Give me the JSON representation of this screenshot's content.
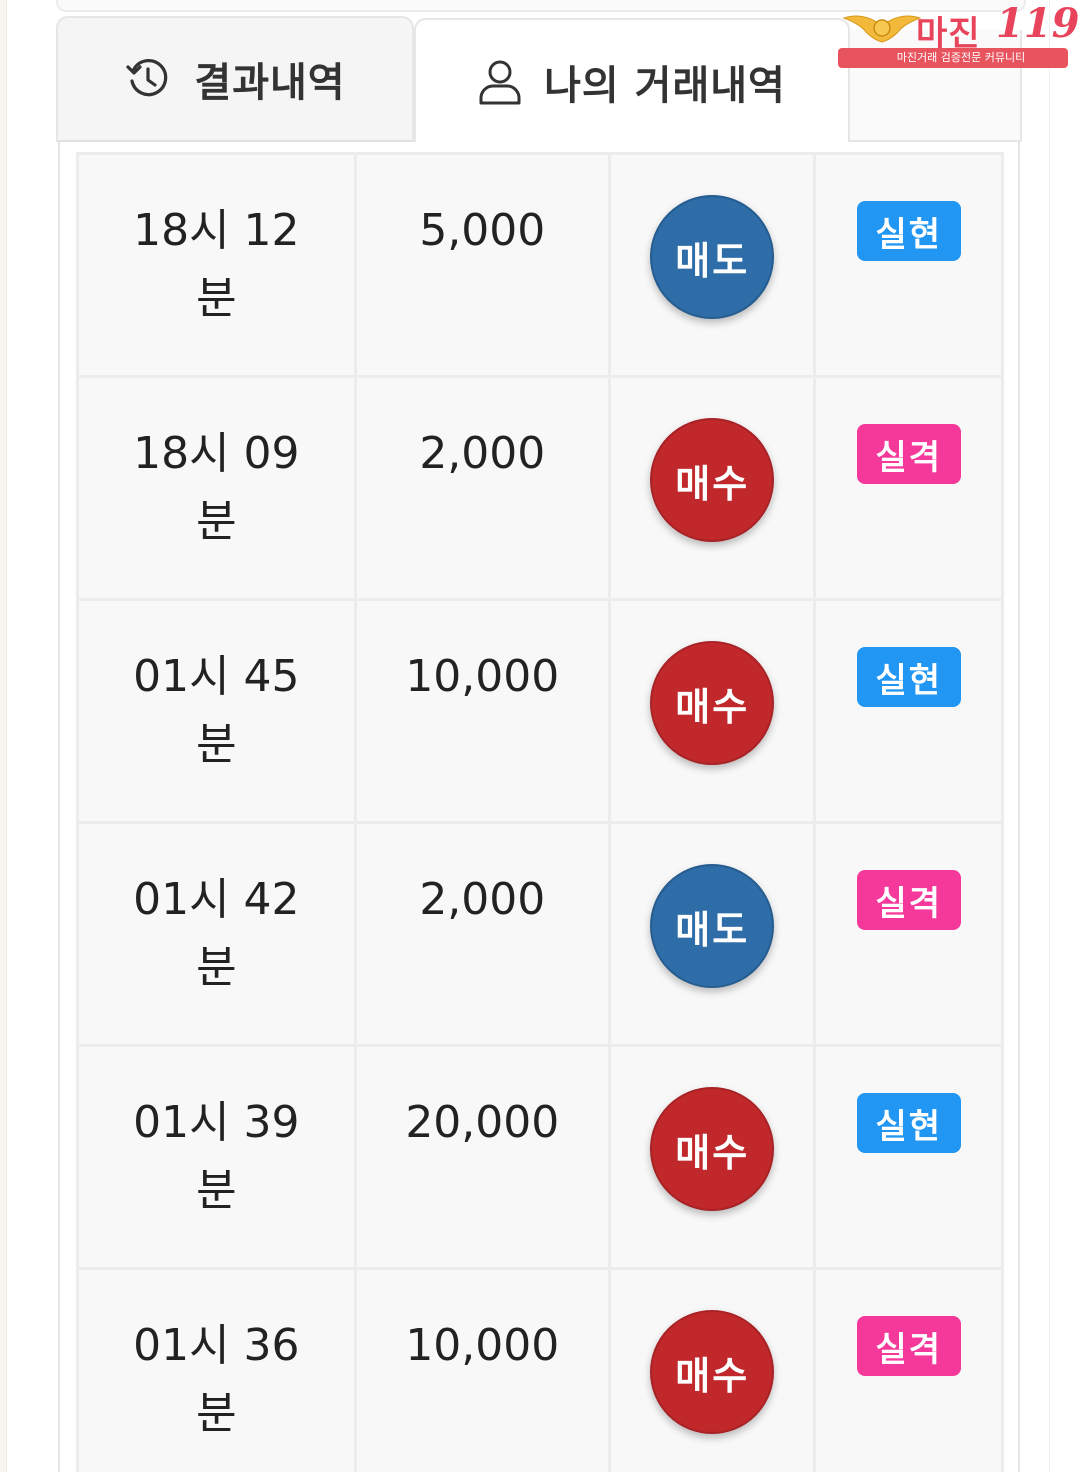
{
  "tabs": [
    {
      "label": "결과내역",
      "icon": "history-icon",
      "active": false
    },
    {
      "label": "나의 거래내역",
      "icon": "user-icon",
      "active": true
    }
  ],
  "watermark": {
    "name": "마진",
    "number": "119",
    "tagline": "마진거래 검증전문 커뮤니티"
  },
  "colors": {
    "sell": "#2e6da8",
    "buy": "#c0282c",
    "win": "#2196f3",
    "lose": "#f5399a"
  },
  "rows": [
    {
      "time_line1": "18시 12",
      "time_line2": "분",
      "amount": "5,000",
      "side": "매도",
      "side_type": "sell",
      "result": "실현",
      "result_type": "win"
    },
    {
      "time_line1": "18시 09",
      "time_line2": "분",
      "amount": "2,000",
      "side": "매수",
      "side_type": "buy",
      "result": "실격",
      "result_type": "lose"
    },
    {
      "time_line1": "01시 45",
      "time_line2": "분",
      "amount": "10,000",
      "side": "매수",
      "side_type": "buy",
      "result": "실현",
      "result_type": "win"
    },
    {
      "time_line1": "01시 42",
      "time_line2": "분",
      "amount": "2,000",
      "side": "매도",
      "side_type": "sell",
      "result": "실격",
      "result_type": "lose"
    },
    {
      "time_line1": "01시 39",
      "time_line2": "분",
      "amount": "20,000",
      "side": "매수",
      "side_type": "buy",
      "result": "실현",
      "result_type": "win"
    },
    {
      "time_line1": "01시 36",
      "time_line2": "분",
      "amount": "10,000",
      "side": "매수",
      "side_type": "buy",
      "result": "실격",
      "result_type": "lose"
    }
  ]
}
